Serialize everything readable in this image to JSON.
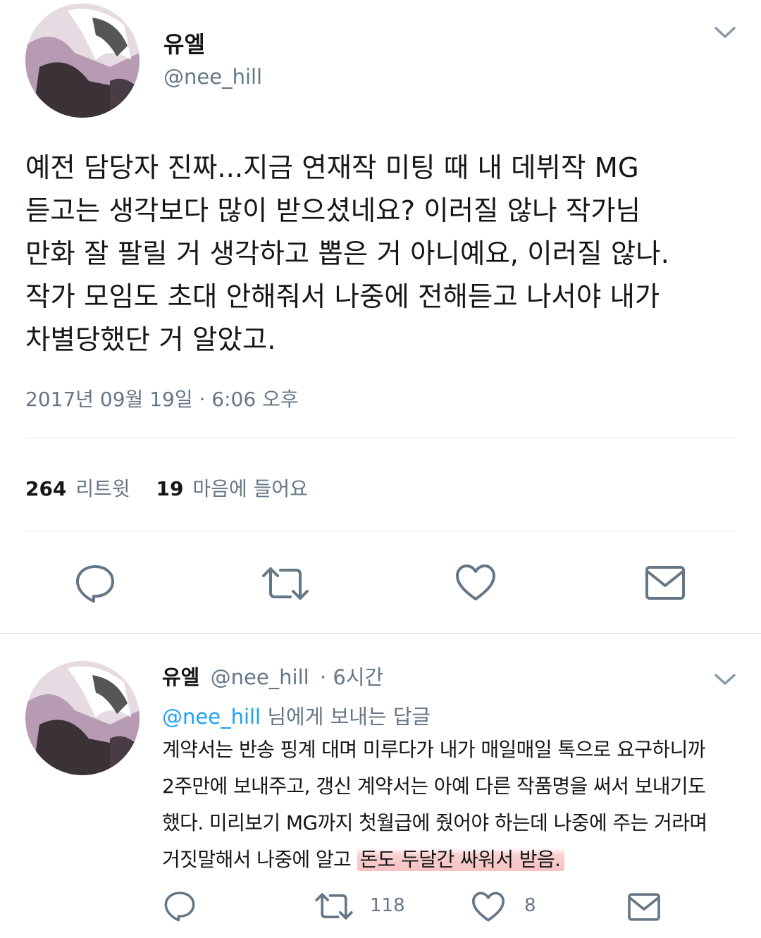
{
  "main_tweet": {
    "display_name": "유엘",
    "handle": "@nee_hill",
    "lines": [
      "예전 담당자 진짜...지금 연재작 미팅 때 내 데뷔작 MG",
      "듣고는 생각보다 많이 받으셨네요? 이러질 않나 작가님",
      "만화 잘 팔릴 거 생각하고 뽑은 거 아니예요, 이러질 않나.",
      "작가 모임도 초대 안해줘서 나중에 전해듣고 나서야 내가",
      "차별당했단 거 알았고."
    ],
    "timestamp": "2017년 09월 19일 · 6:06 오후",
    "retweet_count": "264",
    "retweet_label": "리트윗",
    "like_count": "19",
    "like_label": "마음에 들어요"
  },
  "reply_tweet": {
    "display_name": "유엘",
    "handle": "@nee_hill",
    "time": "· 6시간",
    "reply_to_handle": "@nee_hill",
    "reply_to_suffix": "님에게 보내는 답글",
    "lines": [
      "계약서는 반송 핑계 대며 미루다가 내가 매일매일 톡으로 요구하니까",
      "2주만에 보내주고, 갱신 계약서는 아예 다른 작품명을 써서 보내기도",
      "했다. 미리보기 MG까지 첫월급에 줬어야 하는데 나중에 주는 거라며"
    ],
    "last_line_plain": "거짓말해서 나중에 알고 ",
    "last_line_highlight": "돈도 두달간 싸워서 받음.",
    "retweet_count": "118",
    "like_count": "8"
  },
  "icons": [
    "chevron-down-icon",
    "reply-icon",
    "retweet-icon",
    "heart-icon",
    "mail-icon"
  ],
  "colors": {
    "text": "#14171a",
    "muted": "#657786",
    "link": "#1da1f2",
    "highlight": "#f4a8a8"
  }
}
